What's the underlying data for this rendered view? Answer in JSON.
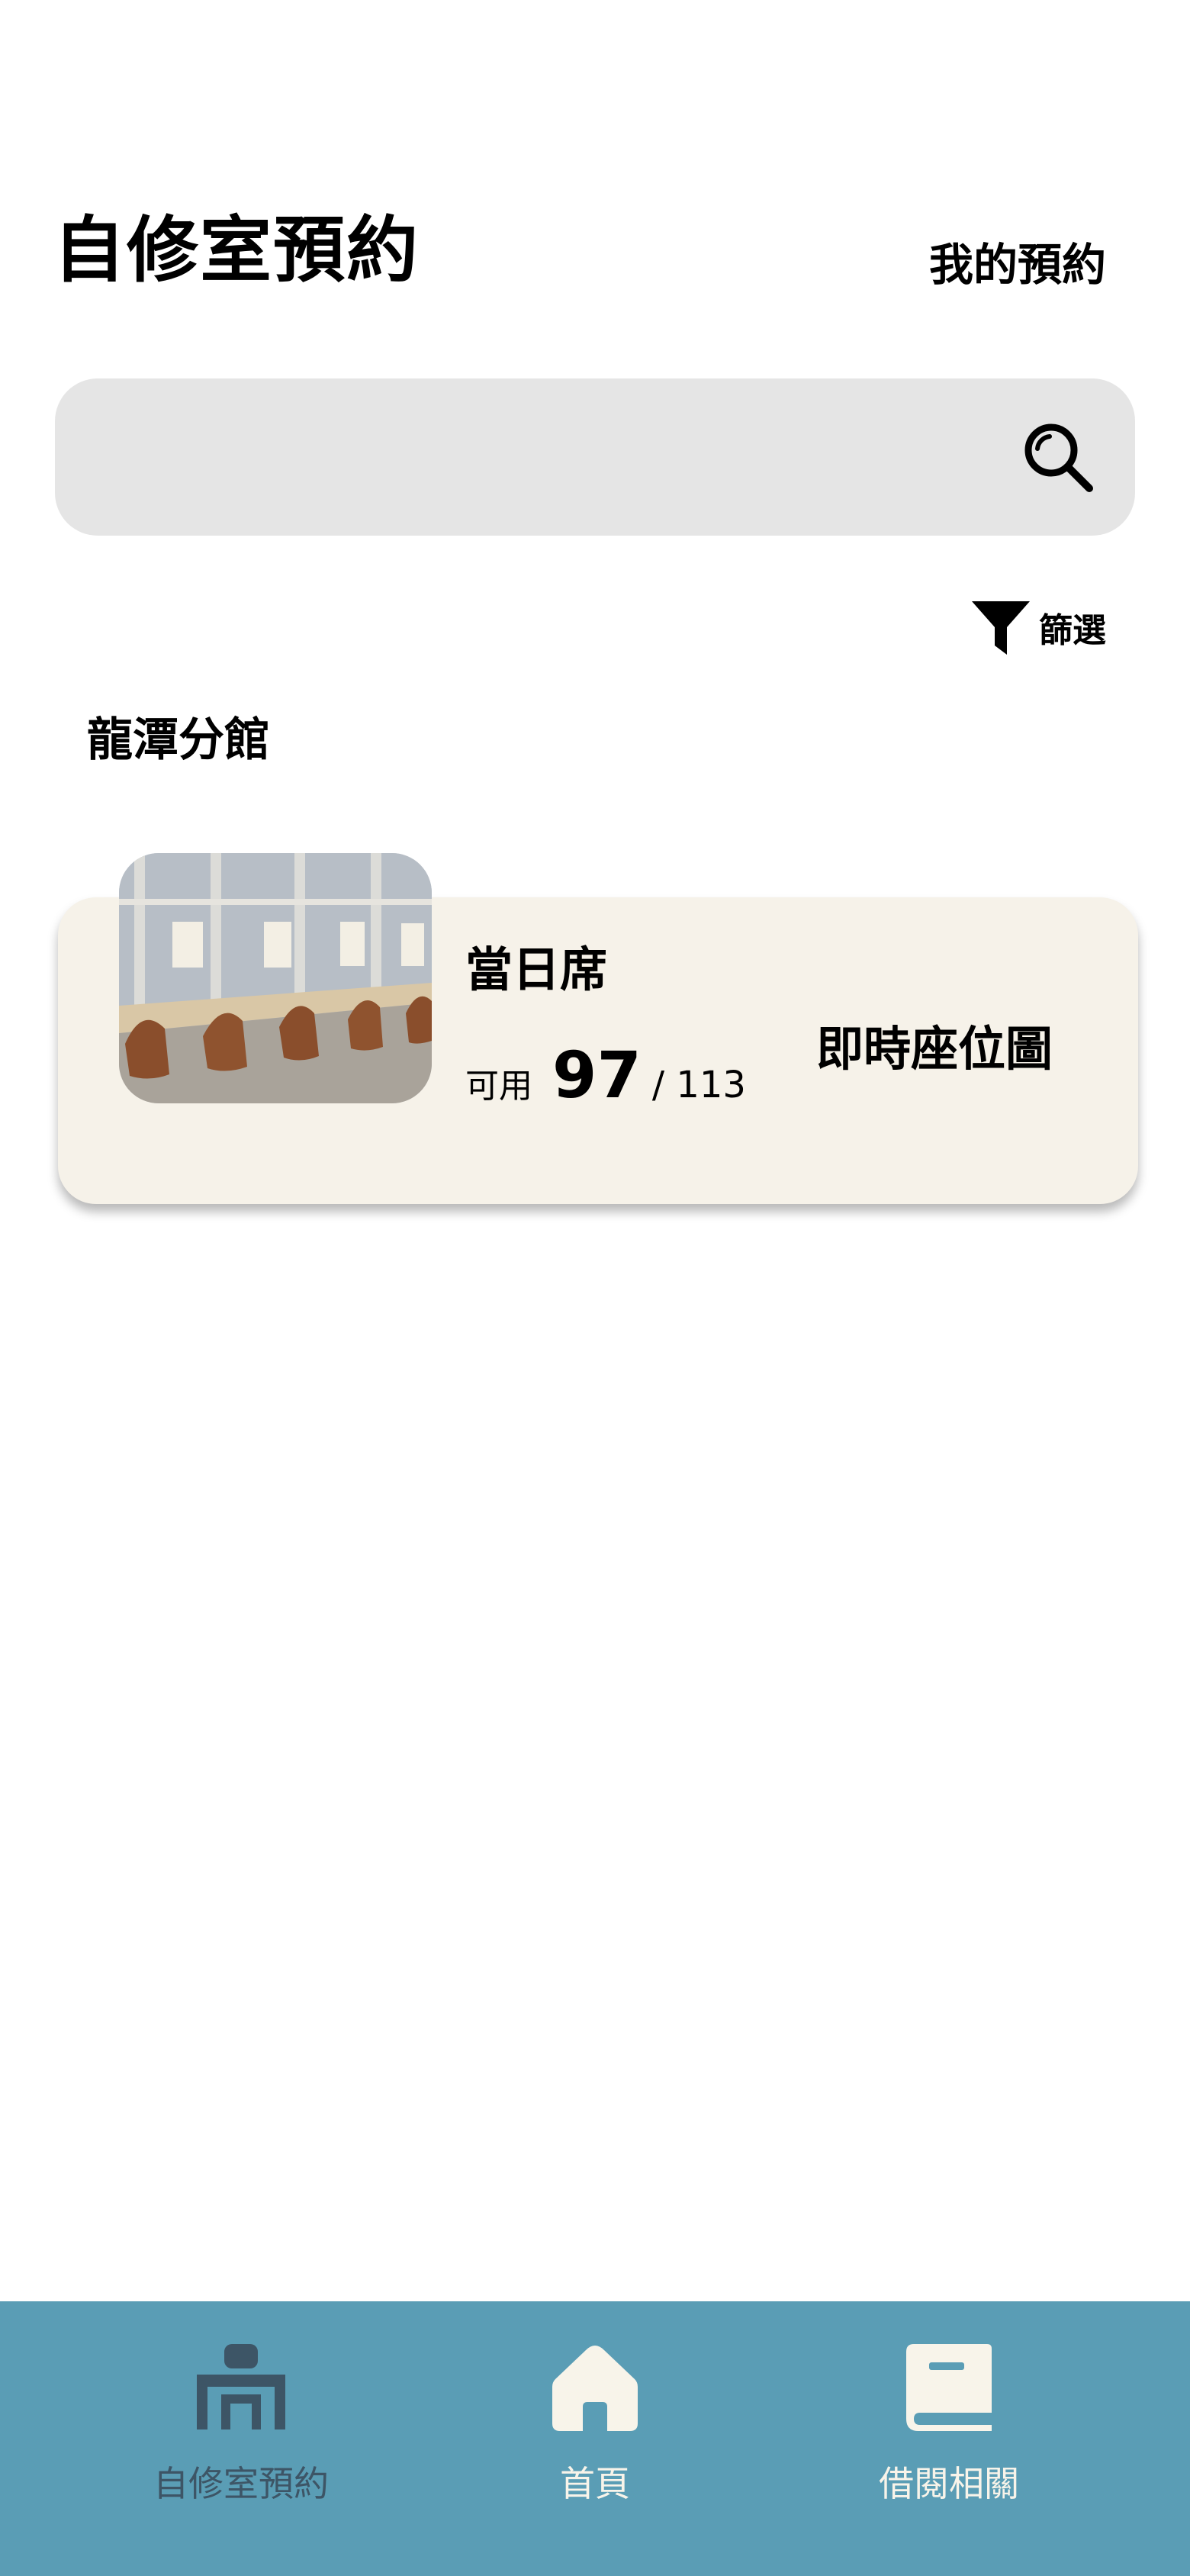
{
  "header": {
    "title": "自修室預約",
    "my_reservations_label": "我的預約"
  },
  "search": {
    "placeholder": "",
    "value": "",
    "icon": "search-icon"
  },
  "filter": {
    "label": "篩選",
    "icon": "filter-icon"
  },
  "branch": {
    "name": "龍潭分館"
  },
  "rooms": [
    {
      "title": "當日席",
      "available_label": "可用",
      "available_count": "97",
      "total_text": "/ 113",
      "seat_map_label": "即時座位圖",
      "photo": "study-room-photo"
    }
  ],
  "bottom_nav": {
    "items": [
      {
        "label": "自修室預約",
        "icon": "study-desk-icon",
        "active": true
      },
      {
        "label": "首頁",
        "icon": "home-icon",
        "active": false
      },
      {
        "label": "借閱相關",
        "icon": "book-icon",
        "active": false
      }
    ]
  },
  "colors": {
    "nav_background": "#5a9db5",
    "nav_active": "#3d5566",
    "nav_inactive": "#f8f4ea",
    "card_background": "#f6f2e9",
    "search_background": "#e5e5e5"
  }
}
